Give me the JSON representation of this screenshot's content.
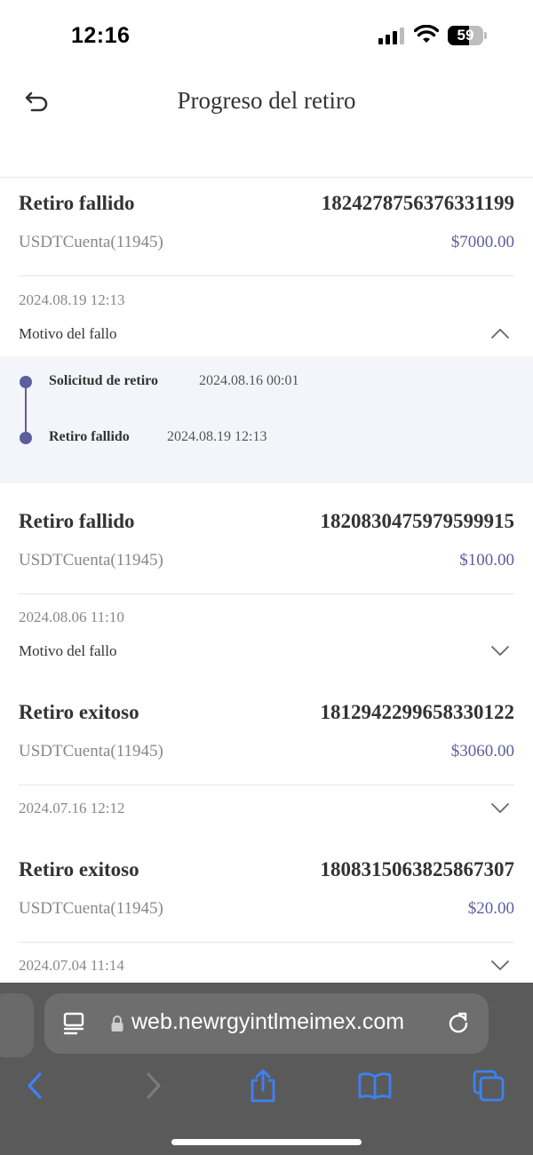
{
  "status_bar": {
    "time": "12:16",
    "battery": "59",
    "battery_level": 0.59
  },
  "header": {
    "title": "Progreso del retiro"
  },
  "withdrawals": [
    {
      "status": "Retiro fallido",
      "id": "1824278756376331199",
      "account": "USDTCuenta(11945)",
      "amount": "$7000.00",
      "date": "2024.08.19 12:13",
      "reason_label": "Motivo del fallo",
      "expanded": true,
      "timeline": [
        {
          "label": "Solicitud de retiro",
          "time": "2024.08.16 00:01"
        },
        {
          "label": "Retiro fallido",
          "time": "2024.08.19 12:13"
        }
      ]
    },
    {
      "status": "Retiro fallido",
      "id": "1820830475979599915",
      "account": "USDTCuenta(11945)",
      "amount": "$100.00",
      "date": "2024.08.06 11:10",
      "reason_label": "Motivo del fallo",
      "expanded": false
    },
    {
      "status": "Retiro exitoso",
      "id": "1812942299658330122",
      "account": "USDTCuenta(11945)",
      "amount": "$3060.00",
      "date": "2024.07.16 12:12",
      "expanded": false
    },
    {
      "status": "Retiro exitoso",
      "id": "1808315063825867307",
      "account": "USDTCuenta(11945)",
      "amount": "$20.00",
      "date": "2024.07.04 11:14",
      "expanded": false
    }
  ],
  "browser": {
    "url": "web.newrgyintlmeimex.com"
  },
  "colors": {
    "accent": "#5c5e9e",
    "timeline_bg": "#f4f5fa",
    "toolbar_icon": "#3b82f6",
    "toolbar_bg": "#5a5a5a"
  },
  "icons": {
    "back": "undo-arrow-icon",
    "collapse": "chevron-up-icon",
    "expand": "chevron-down-icon",
    "reader": "reader-mode-icon",
    "lock": "lock-icon",
    "reload": "reload-icon",
    "toolbar": [
      "chevron-left-icon",
      "chevron-right-icon",
      "share-icon",
      "bookmarks-icon",
      "tabs-icon"
    ]
  }
}
